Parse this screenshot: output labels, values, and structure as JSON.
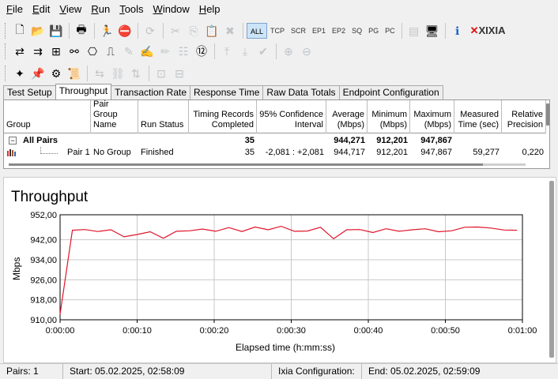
{
  "menu": {
    "items": [
      {
        "pre": "",
        "u": "F",
        "post": "ile"
      },
      {
        "pre": "",
        "u": "E",
        "post": "dit"
      },
      {
        "pre": "",
        "u": "V",
        "post": "iew"
      },
      {
        "pre": "",
        "u": "R",
        "post": "un"
      },
      {
        "pre": "",
        "u": "T",
        "post": "ools"
      },
      {
        "pre": "",
        "u": "W",
        "post": "indow"
      },
      {
        "pre": "",
        "u": "H",
        "post": "elp"
      }
    ]
  },
  "toolbar": {
    "filters": [
      "ALL",
      "TCP",
      "SCR",
      "EP1",
      "EP2",
      "SQ",
      "PG",
      "PC"
    ],
    "selected_filter": "ALL",
    "brand": "XIXIA"
  },
  "tabs": [
    "Test Setup",
    "Throughput",
    "Transaction Rate",
    "Response Time",
    "Raw Data Totals",
    "Endpoint Configuration"
  ],
  "active_tab": "Throughput",
  "grid": {
    "headers": [
      "Group",
      "Pair Group Name",
      "Run Status",
      "Timing Records Completed",
      "95% Confidence Interval",
      "Average (Mbps)",
      "Minimum (Mbps)",
      "Maximum (Mbps)",
      "Measured Time (sec)",
      "Relative Precision"
    ],
    "all_pairs": {
      "label": "All Pairs",
      "records": "35",
      "average": "944,271",
      "minimum": "912,201",
      "maximum": "947,867"
    },
    "pair1": {
      "label": "Pair 1",
      "group_name": "No Group",
      "status": "Finished",
      "records": "35",
      "confidence": "-2,081 : +2,081",
      "average": "944,717",
      "minimum": "912,201",
      "maximum": "947,867",
      "measured_time": "59,277",
      "precision": "0,220"
    }
  },
  "chart": {
    "title": "Throughput",
    "xlabel": "Elapsed time (h:mm:ss)",
    "ylabel": "Mbps"
  },
  "chart_data": {
    "type": "line",
    "title": "Throughput",
    "xlabel": "Elapsed time (h:mm:ss)",
    "ylabel": "Mbps",
    "xlim": [
      0,
      60
    ],
    "ylim": [
      910,
      952
    ],
    "yticks": [
      "952,00",
      "942,00",
      "934,00",
      "926,00",
      "918,00",
      "910,00"
    ],
    "xticks": [
      "0:00:00",
      "0:00:10",
      "0:00:20",
      "0:00:30",
      "0:00:40",
      "0:00:50",
      "0:01:00"
    ],
    "line_color": "#e0142a",
    "series": [
      {
        "x": [
          0,
          1.6,
          3.2,
          4.9,
          6.6,
          8.3,
          10.0,
          11.7,
          13.4,
          15.1,
          16.8,
          18.5,
          20.2,
          21.9,
          23.6,
          25.3,
          27.0,
          28.7,
          30.4,
          32.1,
          33.8,
          35.5,
          37.2,
          38.9,
          40.6,
          42.3,
          44.0,
          45.7,
          47.4,
          49.1,
          50.8,
          52.5,
          54.2,
          55.9,
          57.6,
          59.3
        ],
        "y": [
          912.2,
          945.8,
          946.1,
          945.3,
          946.0,
          943.2,
          944.1,
          945.2,
          942.6,
          945.4,
          945.6,
          946.3,
          945.4,
          946.9,
          945.3,
          947.1,
          946.0,
          947.4,
          945.4,
          945.5,
          947.0,
          942.4,
          946.0,
          946.1,
          944.9,
          946.4,
          945.4,
          946.0,
          946.4,
          945.2,
          945.6,
          947.0,
          947.1,
          946.7,
          945.9,
          945.8
        ]
      }
    ]
  },
  "status": {
    "pairs": "Pairs: 1",
    "start": "Start: 05.02.2025, 02:58:09",
    "ixia_config": "Ixia Configuration:",
    "end": "End: 05.02.2025, 02:59:09"
  }
}
